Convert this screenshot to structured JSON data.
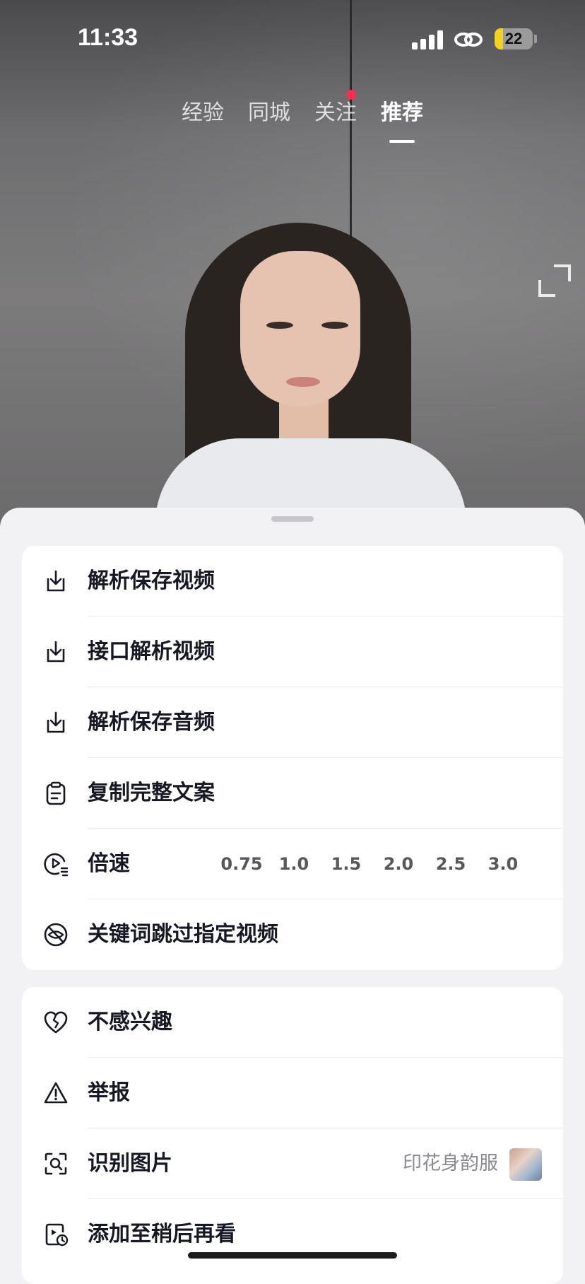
{
  "status_bar": {
    "time": "11:33",
    "battery": "22"
  },
  "top_tabs": [
    {
      "label": "经验",
      "active": false
    },
    {
      "label": "同城",
      "active": false
    },
    {
      "label": "关注",
      "active": false,
      "has_dot": true
    },
    {
      "label": "推荐",
      "active": true
    }
  ],
  "menu_group_1": [
    {
      "label": "解析保存视频",
      "icon": "download-icon"
    },
    {
      "label": "接口解析视频",
      "icon": "download-icon"
    },
    {
      "label": "解析保存音频",
      "icon": "download-icon"
    },
    {
      "label": "复制完整文案",
      "icon": "clipboard-icon"
    },
    {
      "label": "倍速",
      "icon": "playback-speed-icon",
      "speeds": [
        "0.75",
        "1.0",
        "1.5",
        "2.0",
        "2.5",
        "3.0"
      ]
    },
    {
      "label": "关键词跳过指定视频",
      "icon": "block-eye-icon"
    }
  ],
  "menu_group_2": [
    {
      "label": "不感兴趣",
      "icon": "broken-heart-icon"
    },
    {
      "label": "举报",
      "icon": "warning-icon"
    },
    {
      "label": "识别图片",
      "icon": "scan-image-icon",
      "right_text": "印花身韵服"
    },
    {
      "label": "添加至稍后再看",
      "icon": "watch-later-icon"
    }
  ],
  "colors": {
    "accent_dot": "#fe2c55",
    "text": "#161823",
    "sheet_bg": "#f2f2f4"
  }
}
